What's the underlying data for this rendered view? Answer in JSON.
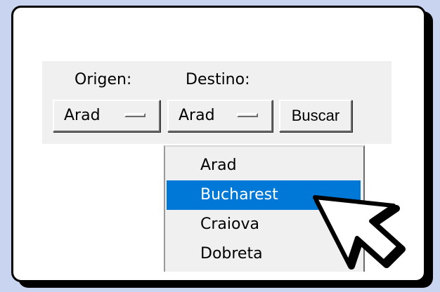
{
  "form": {
    "origen_label": "Origen:",
    "destino_label": "Destino:",
    "origen_value": "Arad",
    "destino_value": "Arad",
    "search_label": "Buscar"
  },
  "dropdown": {
    "items": [
      "Arad",
      "Bucharest",
      "Craiova",
      "Dobreta"
    ],
    "highlighted": "Bucharest"
  },
  "colors": {
    "highlight": "#0078d7",
    "panel": "#f0f0f0",
    "background": "#c9d5f0"
  },
  "icons": {
    "pointer": "mouse-pointer-icon"
  }
}
